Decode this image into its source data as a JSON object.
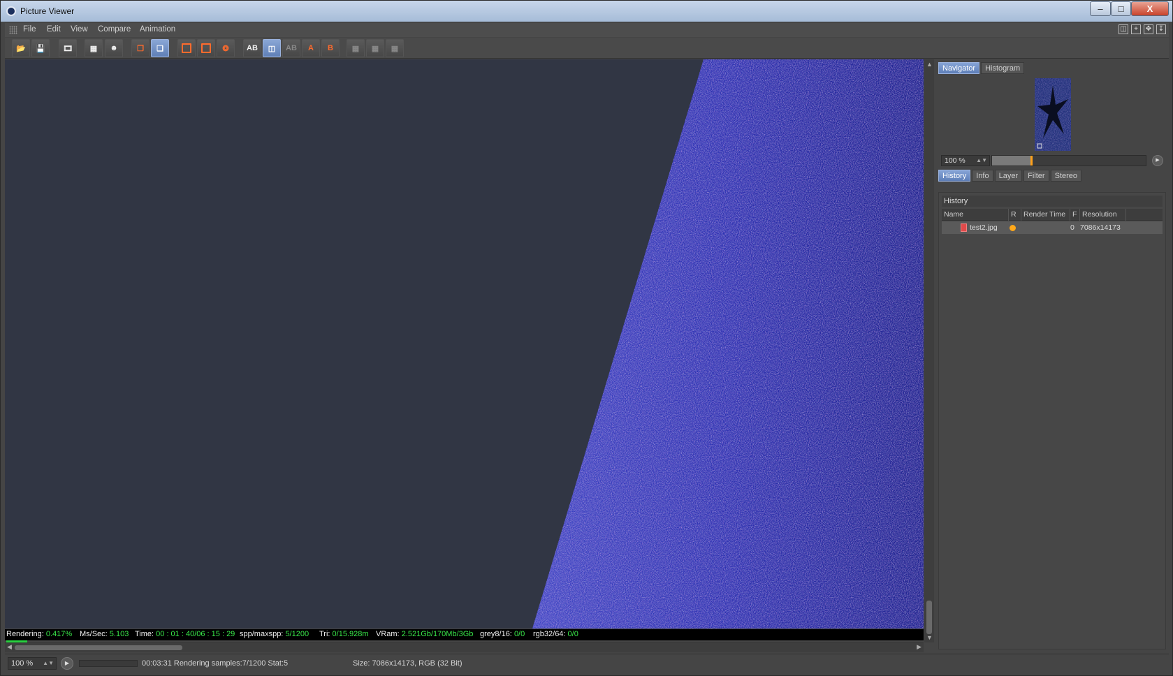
{
  "window": {
    "title": "Picture Viewer",
    "min": "–",
    "max": "□",
    "close": "X"
  },
  "menu": [
    "File",
    "Edit",
    "View",
    "Compare",
    "Animation"
  ],
  "toolbar_labels": {
    "ab": "AB",
    "a": "A",
    "b": "B"
  },
  "status": {
    "rendering_k": "Rendering:",
    "rendering_v": "0.417%",
    "mssec_k": "Ms/Sec:",
    "mssec_v": "5.103",
    "time_k": "Time:",
    "time_v": "00 : 01 : 40/06 : 15 : 29",
    "spp_k": "spp/maxspp:",
    "spp_v": "5/1200",
    "tri_k": "Tri:",
    "tri_v": "0/15.928m",
    "vram_k": "VRam:",
    "vram_v": "2.521Gb/170Mb/3Gb",
    "grey_k": "grey8/16:",
    "grey_v": "0/0",
    "rgb_k": "rgb32/64:",
    "rgb_v": "0/0"
  },
  "bottom": {
    "zoom": "100 %",
    "message": "00:03:31 Rendering samples:7/1200 Stat:5",
    "size": "Size: 7086x14173, RGB (32 Bit)"
  },
  "navigator": {
    "tabs": [
      "Navigator",
      "Histogram"
    ],
    "zoom": "100 %",
    "zoom_fraction": 0.25
  },
  "panel_tabs": [
    "History",
    "Info",
    "Layer",
    "Filter",
    "Stereo"
  ],
  "history": {
    "title": "History",
    "columns": [
      "Name",
      "R",
      "Render Time",
      "F",
      "Resolution"
    ],
    "rows": [
      {
        "name": "test2.jpg",
        "render_time": "",
        "f": "0",
        "resolution": "7086x14173"
      }
    ]
  },
  "colors": {
    "accent": "#6f8fc8",
    "status_value": "#39e84a",
    "render_blue": "#2a2fb0",
    "background": "#313644"
  }
}
